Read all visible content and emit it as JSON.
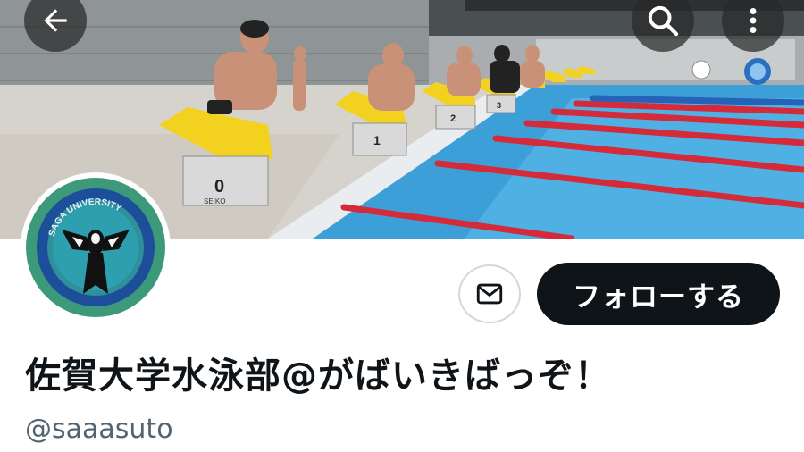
{
  "header": {
    "back_icon": "arrow-left-icon",
    "search_icon": "search-icon",
    "more_icon": "more-vertical-icon"
  },
  "banner": {
    "description_colors": {
      "pool_water": "#3d9fd8",
      "lane_rope_red": "#d42a3a",
      "blocks_yellow": "#f2d21f"
    },
    "block_numbers": [
      "0",
      "1",
      "2",
      "3"
    ],
    "block_brand": "SEIKO"
  },
  "avatar": {
    "emblem_text": "SAGA UNIVERSITY",
    "icon": "university-crest-icon"
  },
  "actions": {
    "message_icon": "mail-icon",
    "follow_label": "フォローする"
  },
  "profile": {
    "display_name": "佐賀大学水泳部@がばいきばっぞ！",
    "handle": "@saaasuto"
  },
  "colors": {
    "follow_bg": "#0f1419",
    "handle_text": "#536471"
  }
}
